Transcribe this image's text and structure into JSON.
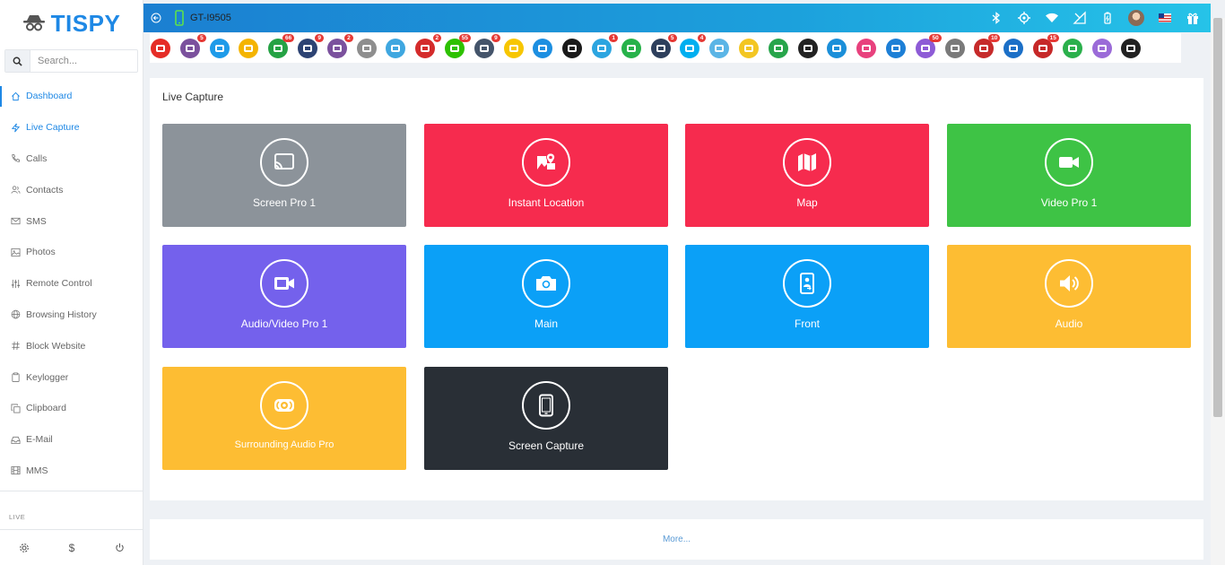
{
  "brand": {
    "name": "TISPY"
  },
  "search": {
    "placeholder": "Search..."
  },
  "sidebar": {
    "items": [
      {
        "label": "Dashboard",
        "icon": "home-icon"
      },
      {
        "label": "Live Capture",
        "icon": "bolt-icon"
      },
      {
        "label": "Calls",
        "icon": "phone-icon"
      },
      {
        "label": "Contacts",
        "icon": "users-icon"
      },
      {
        "label": "SMS",
        "icon": "mail-icon"
      },
      {
        "label": "Photos",
        "icon": "image-icon"
      },
      {
        "label": "Remote Control",
        "icon": "sliders-icon"
      },
      {
        "label": "Browsing History",
        "icon": "globe-icon"
      },
      {
        "label": "Block Website",
        "icon": "hash-icon"
      },
      {
        "label": "Keylogger",
        "icon": "clipboard-icon"
      },
      {
        "label": "Clipboard",
        "icon": "copy-icon"
      },
      {
        "label": "E-Mail",
        "icon": "inbox-icon"
      },
      {
        "label": "MMS",
        "icon": "film-icon"
      }
    ],
    "section_label": "LIVE",
    "bottom": {
      "settings": "gear-icon",
      "billing": "$",
      "logout": "power-icon"
    }
  },
  "header": {
    "device": "GT-I9505",
    "status_icons": [
      "bluetooth-icon",
      "gps-icon",
      "wifi-icon",
      "signal-icon",
      "battery-icon",
      "avatar",
      "flag-icon",
      "gift-icon"
    ]
  },
  "apps": [
    {
      "name": "youtube",
      "color": "#e52d27",
      "badge": ""
    },
    {
      "name": "viber",
      "color": "#7b519d",
      "badge": "5"
    },
    {
      "name": "email",
      "color": "#1e9be9",
      "badge": ""
    },
    {
      "name": "notes",
      "color": "#f4b400",
      "badge": ""
    },
    {
      "name": "whatsapp",
      "color": "#25a244",
      "badge": "66"
    },
    {
      "name": "facebook",
      "color": "#2d4373",
      "badge": "9"
    },
    {
      "name": "viber-2",
      "color": "#7b519d",
      "badge": "2"
    },
    {
      "name": "clipboard",
      "color": "#8e8e8e",
      "badge": ""
    },
    {
      "name": "screen",
      "color": "#3fa7e0",
      "badge": ""
    },
    {
      "name": "tinder",
      "color": "#d42b2b",
      "badge": "2"
    },
    {
      "name": "wechat",
      "color": "#2dc100",
      "badge": "55"
    },
    {
      "name": "instagram",
      "color": "#44546a",
      "badge": "9"
    },
    {
      "name": "snapchat",
      "color": "#f7c600",
      "badge": ""
    },
    {
      "name": "flickr",
      "color": "#1d8fe1",
      "badge": ""
    },
    {
      "name": "tiktok",
      "color": "#1a1a1a",
      "badge": ""
    },
    {
      "name": "telegram",
      "color": "#2ca5e0",
      "badge": "1"
    },
    {
      "name": "line",
      "color": "#27b24a",
      "badge": ""
    },
    {
      "name": "messenger",
      "color": "#2e3f5c",
      "badge": "5"
    },
    {
      "name": "skype",
      "color": "#00aff0",
      "badge": "4"
    },
    {
      "name": "bip",
      "color": "#5bb5e6",
      "badge": ""
    },
    {
      "name": "kakao",
      "color": "#f3c623",
      "badge": ""
    },
    {
      "name": "hangouts",
      "color": "#27a54b",
      "badge": ""
    },
    {
      "name": "kik",
      "color": "#222222",
      "badge": ""
    },
    {
      "name": "imo",
      "color": "#1b8fd9",
      "badge": ""
    },
    {
      "name": "camera-app",
      "color": "#e8417d",
      "badge": ""
    },
    {
      "name": "hike",
      "color": "#1d7fd6",
      "badge": ""
    },
    {
      "name": "chat",
      "color": "#8d5bd6",
      "badge": "50"
    },
    {
      "name": "zoom",
      "color": "#7a7a7a",
      "badge": ""
    },
    {
      "name": "gallery",
      "color": "#c62a2a",
      "badge": "10"
    },
    {
      "name": "phone-app",
      "color": "#1b6fc7",
      "badge": ""
    },
    {
      "name": "browser",
      "color": "#c62828",
      "badge": "15"
    },
    {
      "name": "download",
      "color": "#2bb04c",
      "badge": ""
    },
    {
      "name": "location",
      "color": "#9b6bd8",
      "badge": ""
    },
    {
      "name": "help",
      "color": "#222222",
      "badge": ""
    }
  ],
  "main": {
    "title": "Live Capture",
    "tiles": [
      {
        "label": "Screen Pro 1",
        "color": "#8c939a",
        "icon": "cast-icon"
      },
      {
        "label": "Instant Location",
        "color": "#f62b4e",
        "icon": "location-photo-icon"
      },
      {
        "label": "Map",
        "color": "#f62b4e",
        "icon": "map-icon"
      },
      {
        "label": "Video Pro 1",
        "color": "#3ec345",
        "icon": "video-icon"
      },
      {
        "label": "Audio/Video Pro 1",
        "color": "#7461ec",
        "icon": "video-icon"
      },
      {
        "label": "Main",
        "color": "#0ba0f7",
        "icon": "camera-icon"
      },
      {
        "label": "Front",
        "color": "#0ba0f7",
        "icon": "front-camera-icon"
      },
      {
        "label": "Audio",
        "color": "#fdbd33",
        "icon": "volume-icon"
      },
      {
        "label": "Surrounding Audio Pro",
        "color": "#fdbd33",
        "icon": "surround-audio-icon"
      },
      {
        "label": "Screen Capture",
        "color": "#292f36",
        "icon": "phone-screen-icon"
      }
    ],
    "more_label": "More..."
  }
}
